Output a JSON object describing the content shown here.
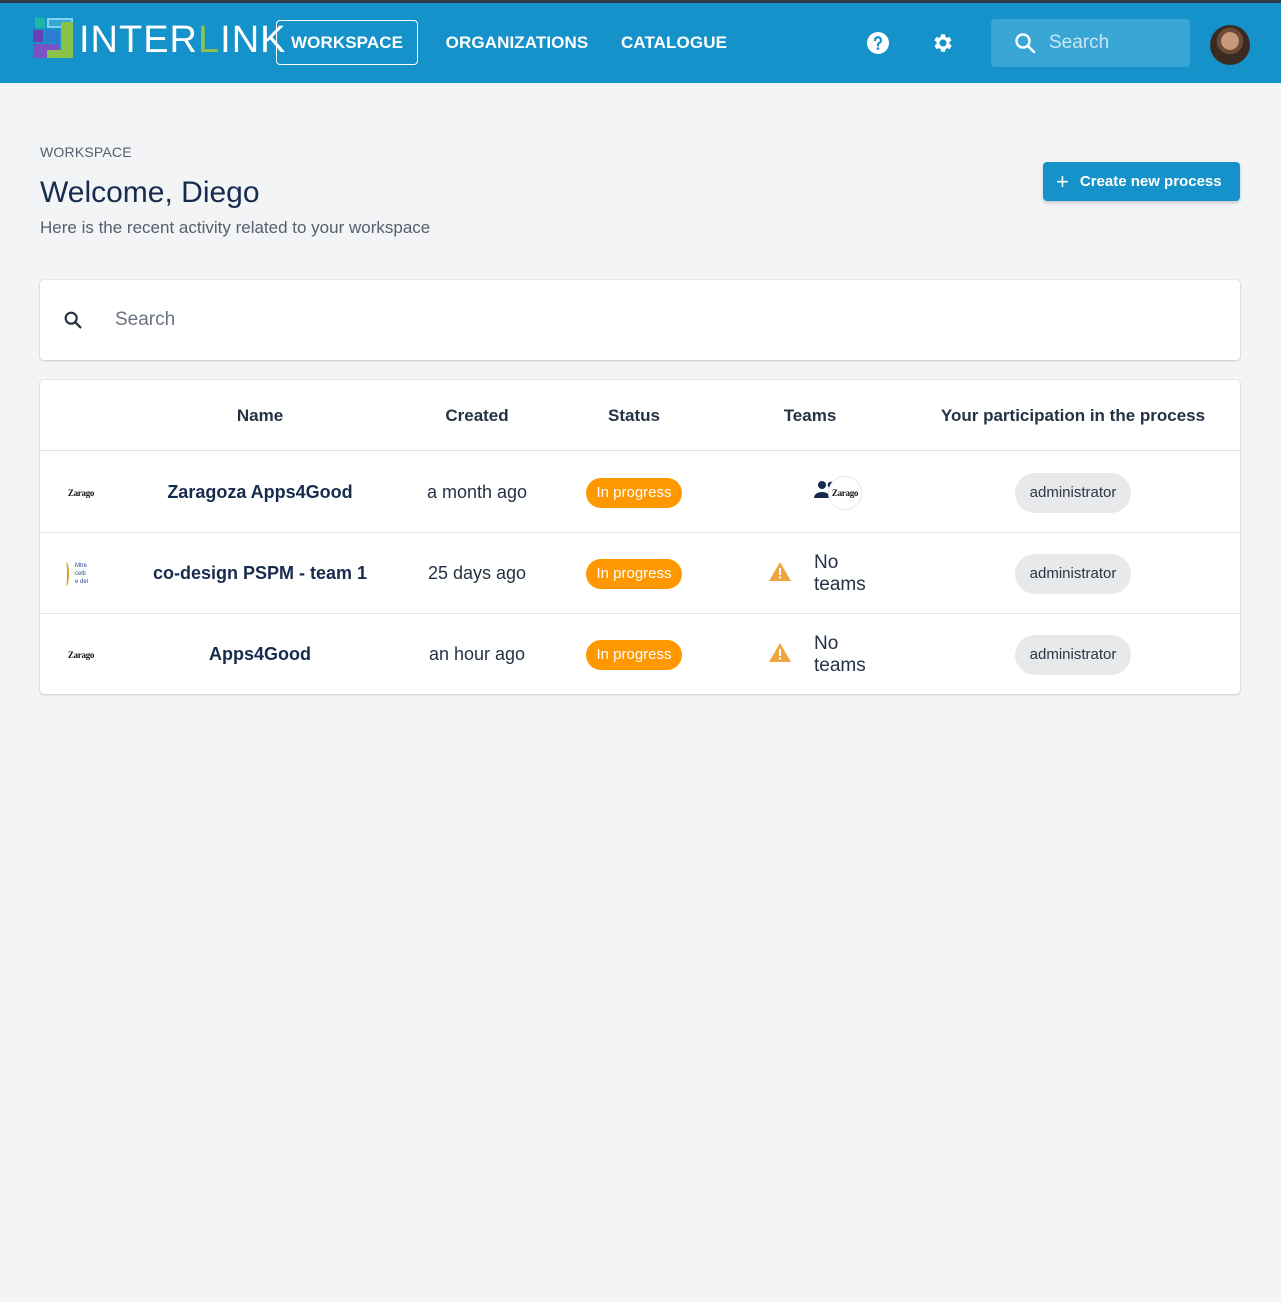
{
  "app": {
    "logo_text_a": "INTER",
    "logo_text_l": "L",
    "logo_text_b": "INK"
  },
  "nav": {
    "workspace": "WORKSPACE",
    "organizations": "ORGANIZATIONS",
    "catalogue": "CATALOGUE"
  },
  "top_search": {
    "placeholder": "Search"
  },
  "header": {
    "overline": "WORKSPACE",
    "title": "Welcome, Diego",
    "subtitle": "Here is the recent activity related to your workspace",
    "create_label": "Create new process"
  },
  "search": {
    "placeholder": "Search"
  },
  "table": {
    "columns": [
      "Name",
      "Created",
      "Status",
      "Teams",
      "Your participation in the process"
    ],
    "rows": [
      {
        "logo": "Zarago",
        "name": "Zaragoza Apps4Good",
        "created": "a month ago",
        "status": "In progress",
        "teams": "",
        "team_logo": "Zarago",
        "role": "administrator"
      },
      {
        "logo": "bs",
        "logo_lines": [
          "Mtre",
          "celti",
          "e del"
        ],
        "name": "co-design PSPM - team 1",
        "created": "25 days ago",
        "status": "In progress",
        "teams": "No teams",
        "role": "administrator"
      },
      {
        "logo": "Zarago",
        "name": "Apps4Good",
        "created": "an hour ago",
        "status": "In progress",
        "teams": "No teams",
        "role": "administrator"
      }
    ]
  },
  "colors": {
    "brand": "#1592c9",
    "status_in_progress": "#ff9800",
    "warning": "#f0a640"
  },
  "icons": [
    "help-icon",
    "gear-icon",
    "search-icon",
    "plus-icon",
    "people-icon",
    "warning-icon"
  ]
}
